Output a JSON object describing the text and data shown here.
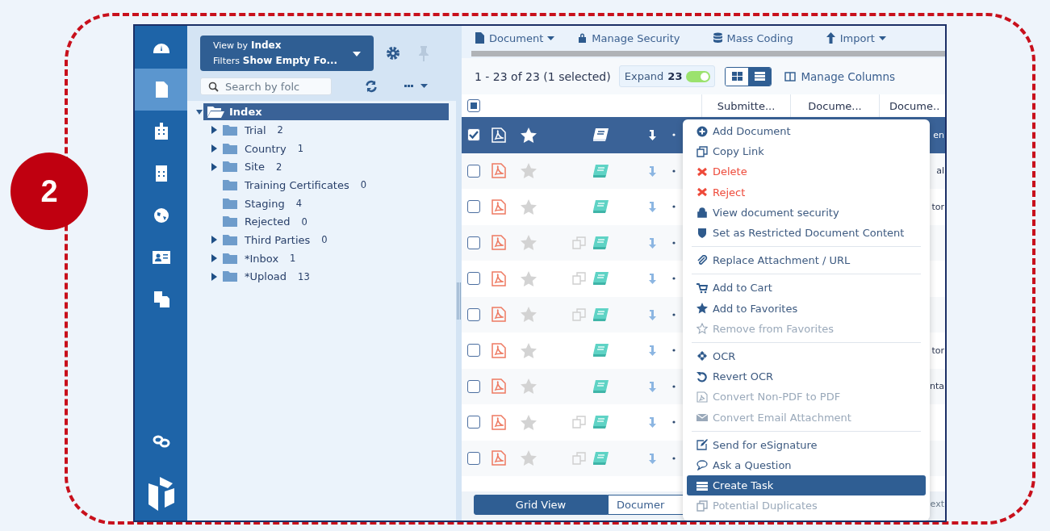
{
  "annotation": {
    "step": "2"
  },
  "rail": {
    "items": [
      {
        "selected": false
      },
      {
        "selected": true
      },
      {
        "selected": false
      },
      {
        "selected": false
      },
      {
        "selected": false
      },
      {
        "selected": false
      },
      {
        "selected": false
      }
    ]
  },
  "folder_panel": {
    "view_by_label": "View by",
    "view_by": "Index",
    "filters_label": "Filters",
    "filters": "Show Empty Fo...",
    "search": {
      "placeholder": "Search by folc"
    },
    "tree": [
      {
        "label": "Index",
        "selected": true,
        "expanded": true,
        "children": [
          {
            "label": "Trial",
            "count": "2",
            "selected": false,
            "expandable": true,
            "expanded": false
          },
          {
            "label": "Country",
            "count": "1",
            "selected": false,
            "expandable": true,
            "expanded": false
          },
          {
            "label": "Site",
            "count": "2",
            "selected": false,
            "expandable": true,
            "expanded": false
          },
          {
            "label": "Training Certificates",
            "count": "0",
            "selected": false,
            "expandable": false
          },
          {
            "label": "Staging",
            "count": "4",
            "selected": false,
            "expandable": false
          },
          {
            "label": "Rejected",
            "count": "0",
            "selected": false,
            "expandable": false
          },
          {
            "label": "Third Parties",
            "count": "0",
            "selected": false,
            "expandable": true,
            "expanded": false
          },
          {
            "label": "*Inbox",
            "count": "1",
            "selected": false,
            "expandable": true,
            "expanded": false
          },
          {
            "label": "*Upload",
            "count": "13",
            "selected": false,
            "expandable": true,
            "expanded": false
          }
        ]
      }
    ]
  },
  "toolbar": [
    {
      "label": "Document",
      "dropdown": true
    },
    {
      "label": "Manage Security",
      "dropdown": false
    },
    {
      "label": "Mass Coding",
      "dropdown": false
    },
    {
      "label": "Import",
      "dropdown": true
    }
  ],
  "summary": "1 - 23 of 23 (1 selected)",
  "expand": {
    "label": "Expand",
    "count": "23",
    "on": true
  },
  "view_modes": [
    {
      "selected": false
    },
    {
      "selected": true
    }
  ],
  "manage_columns": "Manage Columns",
  "table": {
    "select_all": {
      "indeterminate": true
    },
    "columns": [
      "Submitte...",
      "Docume...",
      "Docume.."
    ],
    "rows": [
      {
        "selected": true,
        "checked": true,
        "duplicate": false,
        "column_3": "en"
      },
      {
        "selected": false,
        "checked": false,
        "duplicate": false,
        "column_3": "al"
      },
      {
        "selected": false,
        "checked": false,
        "duplicate": false,
        "column_3": "tor"
      },
      {
        "selected": false,
        "checked": false,
        "duplicate": true
      },
      {
        "selected": false,
        "checked": false,
        "duplicate": true
      },
      {
        "selected": false,
        "checked": false,
        "duplicate": true
      },
      {
        "selected": false,
        "checked": false,
        "duplicate": false,
        "column_3": "tor"
      },
      {
        "selected": false,
        "checked": false,
        "duplicate": false,
        "column_3": "nta"
      },
      {
        "selected": false,
        "checked": false,
        "duplicate": true
      },
      {
        "selected": false,
        "checked": false,
        "duplicate": true
      }
    ]
  },
  "context_menu": {
    "items": [
      {
        "label": "Add Document",
        "kind": "action",
        "selected": false
      },
      {
        "label": "Copy Link",
        "kind": "action",
        "selected": false
      },
      {
        "label": "Delete",
        "kind": "danger",
        "selected": false
      },
      {
        "label": "Reject",
        "kind": "danger",
        "selected": false
      },
      {
        "label": "View document security",
        "kind": "action",
        "selected": false
      },
      {
        "label": "Set as Restricted Document Content",
        "kind": "action",
        "selected": false
      },
      {
        "kind": "separator"
      },
      {
        "label": "Replace Attachment / URL",
        "kind": "action",
        "selected": false
      },
      {
        "kind": "separator"
      },
      {
        "label": "Add to Cart",
        "kind": "action",
        "selected": false
      },
      {
        "label": "Add to Favorites",
        "kind": "action",
        "selected": false
      },
      {
        "label": "Remove from Favorites",
        "kind": "disabled",
        "selected": false
      },
      {
        "kind": "separator"
      },
      {
        "label": "OCR",
        "kind": "action",
        "selected": false
      },
      {
        "label": "Revert OCR",
        "kind": "action",
        "selected": false
      },
      {
        "label": "Convert Non-PDF to PDF",
        "kind": "disabled",
        "selected": false
      },
      {
        "label": "Convert Email Attachment",
        "kind": "disabled",
        "selected": false
      },
      {
        "kind": "separator"
      },
      {
        "label": "Send for eSignature",
        "kind": "action",
        "selected": false
      },
      {
        "label": "Ask a Question",
        "kind": "action",
        "selected": false
      },
      {
        "label": "Create Task",
        "kind": "action",
        "selected": true
      },
      {
        "label": "Potential Duplicates",
        "kind": "disabled",
        "selected": false
      }
    ]
  },
  "bottom_tabs": [
    {
      "label": "Grid View",
      "selected": true
    },
    {
      "label": "Documer",
      "selected": false
    }
  ],
  "bottom_right_text": "ext"
}
